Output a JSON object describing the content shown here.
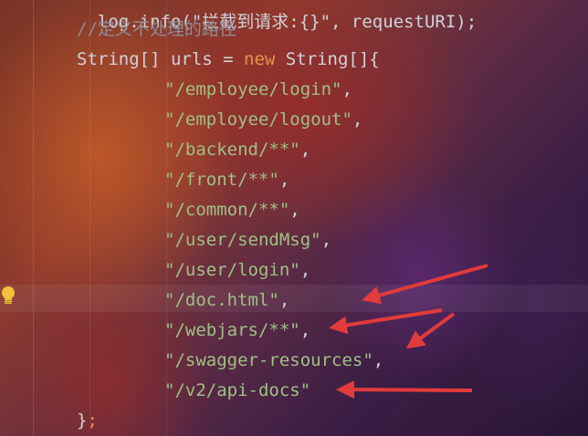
{
  "editor": {
    "partial_top_line": "log.info(\"拦截到请求:{}\", requestURI);",
    "comment": "//定义不处理的路径",
    "decl_type": "String[] urls = ",
    "decl_new": "new",
    "decl_rest": " String[]{",
    "urls": [
      "\"/employee/login\"",
      "\"/employee/logout\"",
      "\"/backend/**\"",
      "\"/front/**\"",
      "\"/common/**\"",
      "\"/user/sendMsg\"",
      "\"/user/login\"",
      "\"/doc.html\"",
      "\"/webjars/**\"",
      "\"/swagger-resources\"",
      "\"/v2/api-docs\""
    ],
    "comma": ",",
    "close_brace": "}",
    "semicolon": ";"
  },
  "gutter": {
    "icon": "lightbulb-icon"
  },
  "annotations": {
    "arrow_color": "#e23b3b",
    "arrow_count": 4
  }
}
